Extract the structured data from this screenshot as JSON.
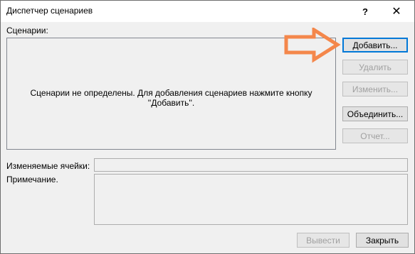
{
  "window": {
    "title": "Диспетчер сценариев",
    "help_glyph": "?",
    "close_glyph": "✕"
  },
  "scenarios": {
    "label": "Сценарии:",
    "empty_message": "Сценарии не определены. Для добавления сценариев нажмите кнопку ''Добавить''."
  },
  "buttons": {
    "add": "Добавить...",
    "delete": "Удалить",
    "edit": "Изменить...",
    "merge": "Объединить...",
    "report": "Отчет...",
    "show": "Вывести",
    "close": "Закрыть"
  },
  "fields": {
    "changing_cells_label": "Изменяемые ячейки:",
    "changing_cells_value": "",
    "comment_label": "Примечание.",
    "comment_value": ""
  },
  "annotation": {
    "arrow_color": "#f4874b",
    "icon": "right-arrow-icon"
  },
  "colors": {
    "dialog_bg": "#f0f0f0",
    "focus_border": "#0078d7"
  }
}
